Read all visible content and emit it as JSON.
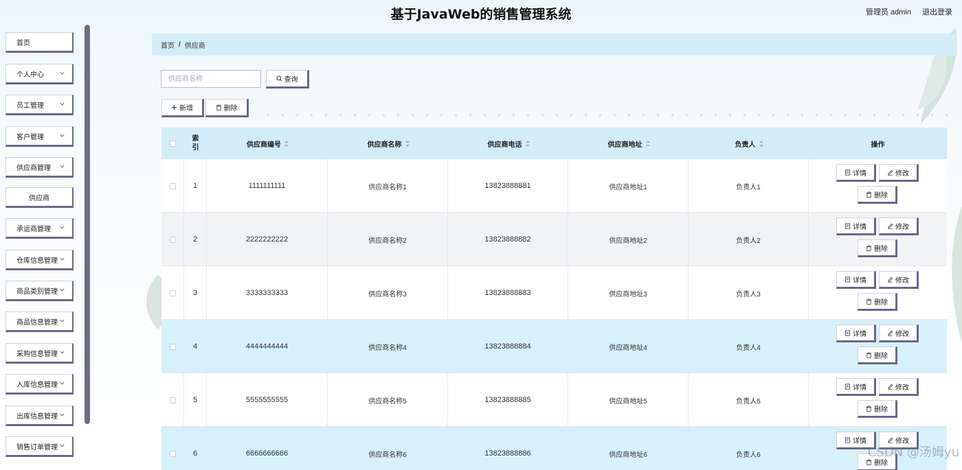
{
  "header": {
    "title": "基于JavaWeb的销售管理系统",
    "user_role": "管理员 admin",
    "logout_label": "退出登录"
  },
  "sidebar": {
    "items": [
      {
        "label": "首页",
        "has_arrow": false
      },
      {
        "label": "个人中心",
        "has_arrow": true
      },
      {
        "label": "员工管理",
        "has_arrow": true
      },
      {
        "label": "客户管理",
        "has_arrow": true
      },
      {
        "label": "供应商管理",
        "has_arrow": true
      },
      {
        "label": "供应商",
        "has_arrow": false,
        "sub": true
      },
      {
        "label": "承运商管理",
        "has_arrow": true
      },
      {
        "label": "仓库信息管理",
        "has_arrow": true
      },
      {
        "label": "商品类别管理",
        "has_arrow": true
      },
      {
        "label": "商品信息管理",
        "has_arrow": true
      },
      {
        "label": "采购信息管理",
        "has_arrow": true
      },
      {
        "label": "入库信息管理",
        "has_arrow": true
      },
      {
        "label": "出库信息管理",
        "has_arrow": true
      },
      {
        "label": "销售订单管理",
        "has_arrow": true
      }
    ]
  },
  "breadcrumb": {
    "home": "首页",
    "separator": "/",
    "current": "供应商"
  },
  "search": {
    "placeholder": "供应商名称",
    "value": "",
    "button_label": "查询"
  },
  "toolbar": {
    "add_label": "新增",
    "delete_label": "删除"
  },
  "table": {
    "headers": {
      "index": "索引",
      "code": "供应商编号",
      "name": "供应商名称",
      "phone": "供应商电话",
      "address": "供应商地址",
      "contact": "负责人",
      "actions": "操作"
    },
    "rows": [
      {
        "index": "1",
        "code": "1111111111",
        "name": "供应商名称1",
        "phone": "13823888881",
        "address": "供应商地址1",
        "contact": "负责人1"
      },
      {
        "index": "2",
        "code": "2222222222",
        "name": "供应商名称2",
        "phone": "13823888882",
        "address": "供应商地址2",
        "contact": "负责人2"
      },
      {
        "index": "3",
        "code": "3333333333",
        "name": "供应商名称3",
        "phone": "13823888883",
        "address": "供应商地址3",
        "contact": "负责人3"
      },
      {
        "index": "4",
        "code": "4444444444",
        "name": "供应商名称4",
        "phone": "13823888884",
        "address": "供应商地址4",
        "contact": "负责人4"
      },
      {
        "index": "5",
        "code": "5555555555",
        "name": "供应商名称5",
        "phone": "13823888885",
        "address": "供应商地址5",
        "contact": "负责人5"
      },
      {
        "index": "6",
        "code": "6666666666",
        "name": "供应商名称6",
        "phone": "13823888886",
        "address": "供应商地址6",
        "contact": "负责人6"
      }
    ],
    "row_actions": {
      "detail": "详情",
      "edit": "修改",
      "delete": "删除"
    }
  },
  "watermark": "CSDN @汤姆yu",
  "colors": {
    "accent_light_blue": "#d3ecf6",
    "button_shadow": "#6b6787",
    "row_gray": "#f2f3f5",
    "row_blue": "#d8f0fa"
  }
}
